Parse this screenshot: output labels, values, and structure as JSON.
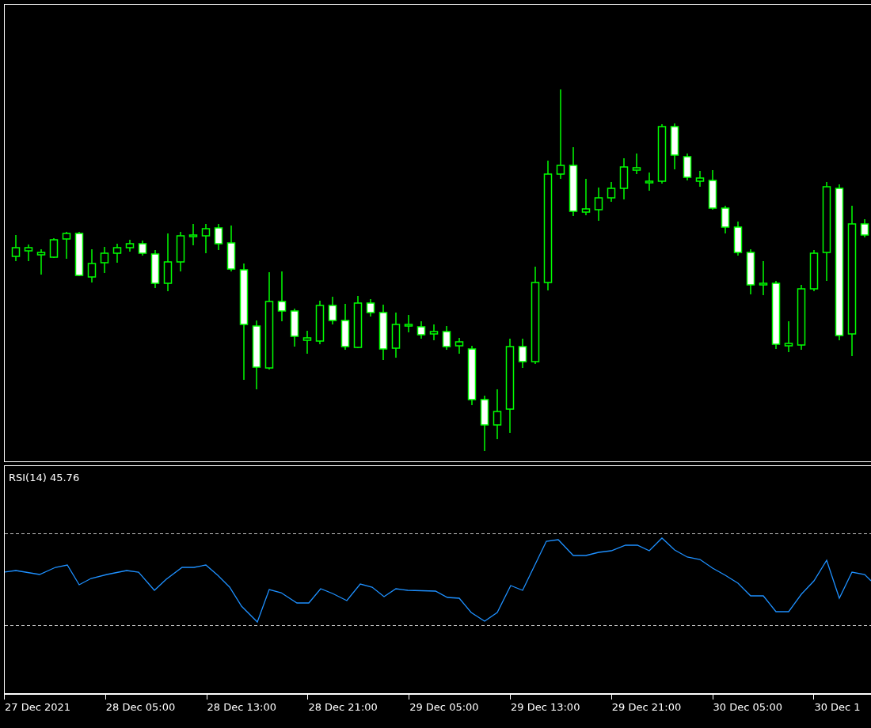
{
  "indicator_panel": {
    "label": "RSI(14) 45.76"
  },
  "time_axis": {
    "labels": [
      "27 Dec 2021",
      "28 Dec 05:00",
      "28 Dec 13:00",
      "28 Dec 21:00",
      "29 Dec 05:00",
      "29 Dec 13:00",
      "29 Dec 21:00",
      "30 Dec 05:00",
      "30 Dec 1"
    ]
  }
}
